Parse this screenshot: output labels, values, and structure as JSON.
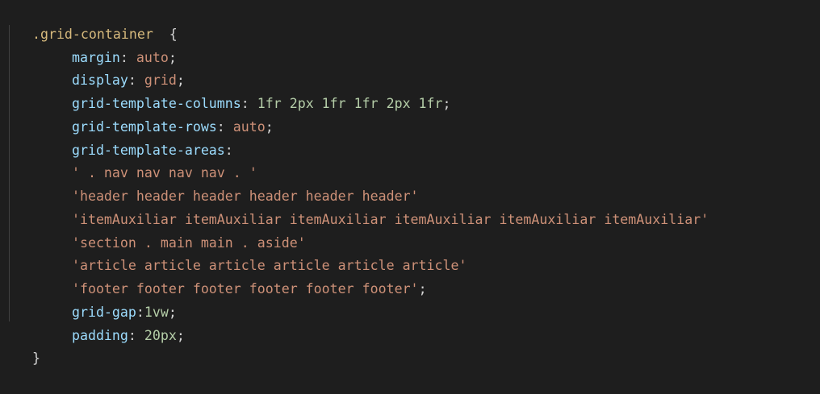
{
  "editor": {
    "lines": [
      {
        "selector": ".grid-container",
        "brace": "  {"
      },
      {
        "prop": "margin",
        "value": "auto"
      },
      {
        "prop": "display",
        "value": "grid"
      },
      {
        "prop": "grid-template-columns",
        "value": "1fr 2px 1fr 1fr 2px 1fr"
      },
      {
        "prop": "grid-template-rows",
        "value": "auto"
      },
      {
        "prop": "grid-template-areas",
        "value": ""
      },
      {
        "string": "' . nav nav nav nav . '"
      },
      {
        "string": "'header header header header header header'"
      },
      {
        "string": "'itemAuxiliar itemAuxiliar itemAuxiliar itemAuxiliar itemAuxiliar itemAuxiliar'"
      },
      {
        "string": "'section . main main . aside'"
      },
      {
        "string": "'article article article article article article'"
      },
      {
        "string": "'footer footer footer footer footer footer'",
        "term": ";"
      },
      {
        "prop": "grid-gap",
        "value": "1vw",
        "nospace": true
      },
      {
        "prop": "padding",
        "value": "20px"
      },
      {
        "close": "}"
      }
    ]
  },
  "colors": {
    "background": "#1e1e1e",
    "selector": "#d7ba7d",
    "property": "#9cdcfe",
    "value": "#ce9178",
    "number": "#b5cea8",
    "punctuation": "#d4d4d4",
    "indent_guide": "#404040"
  }
}
